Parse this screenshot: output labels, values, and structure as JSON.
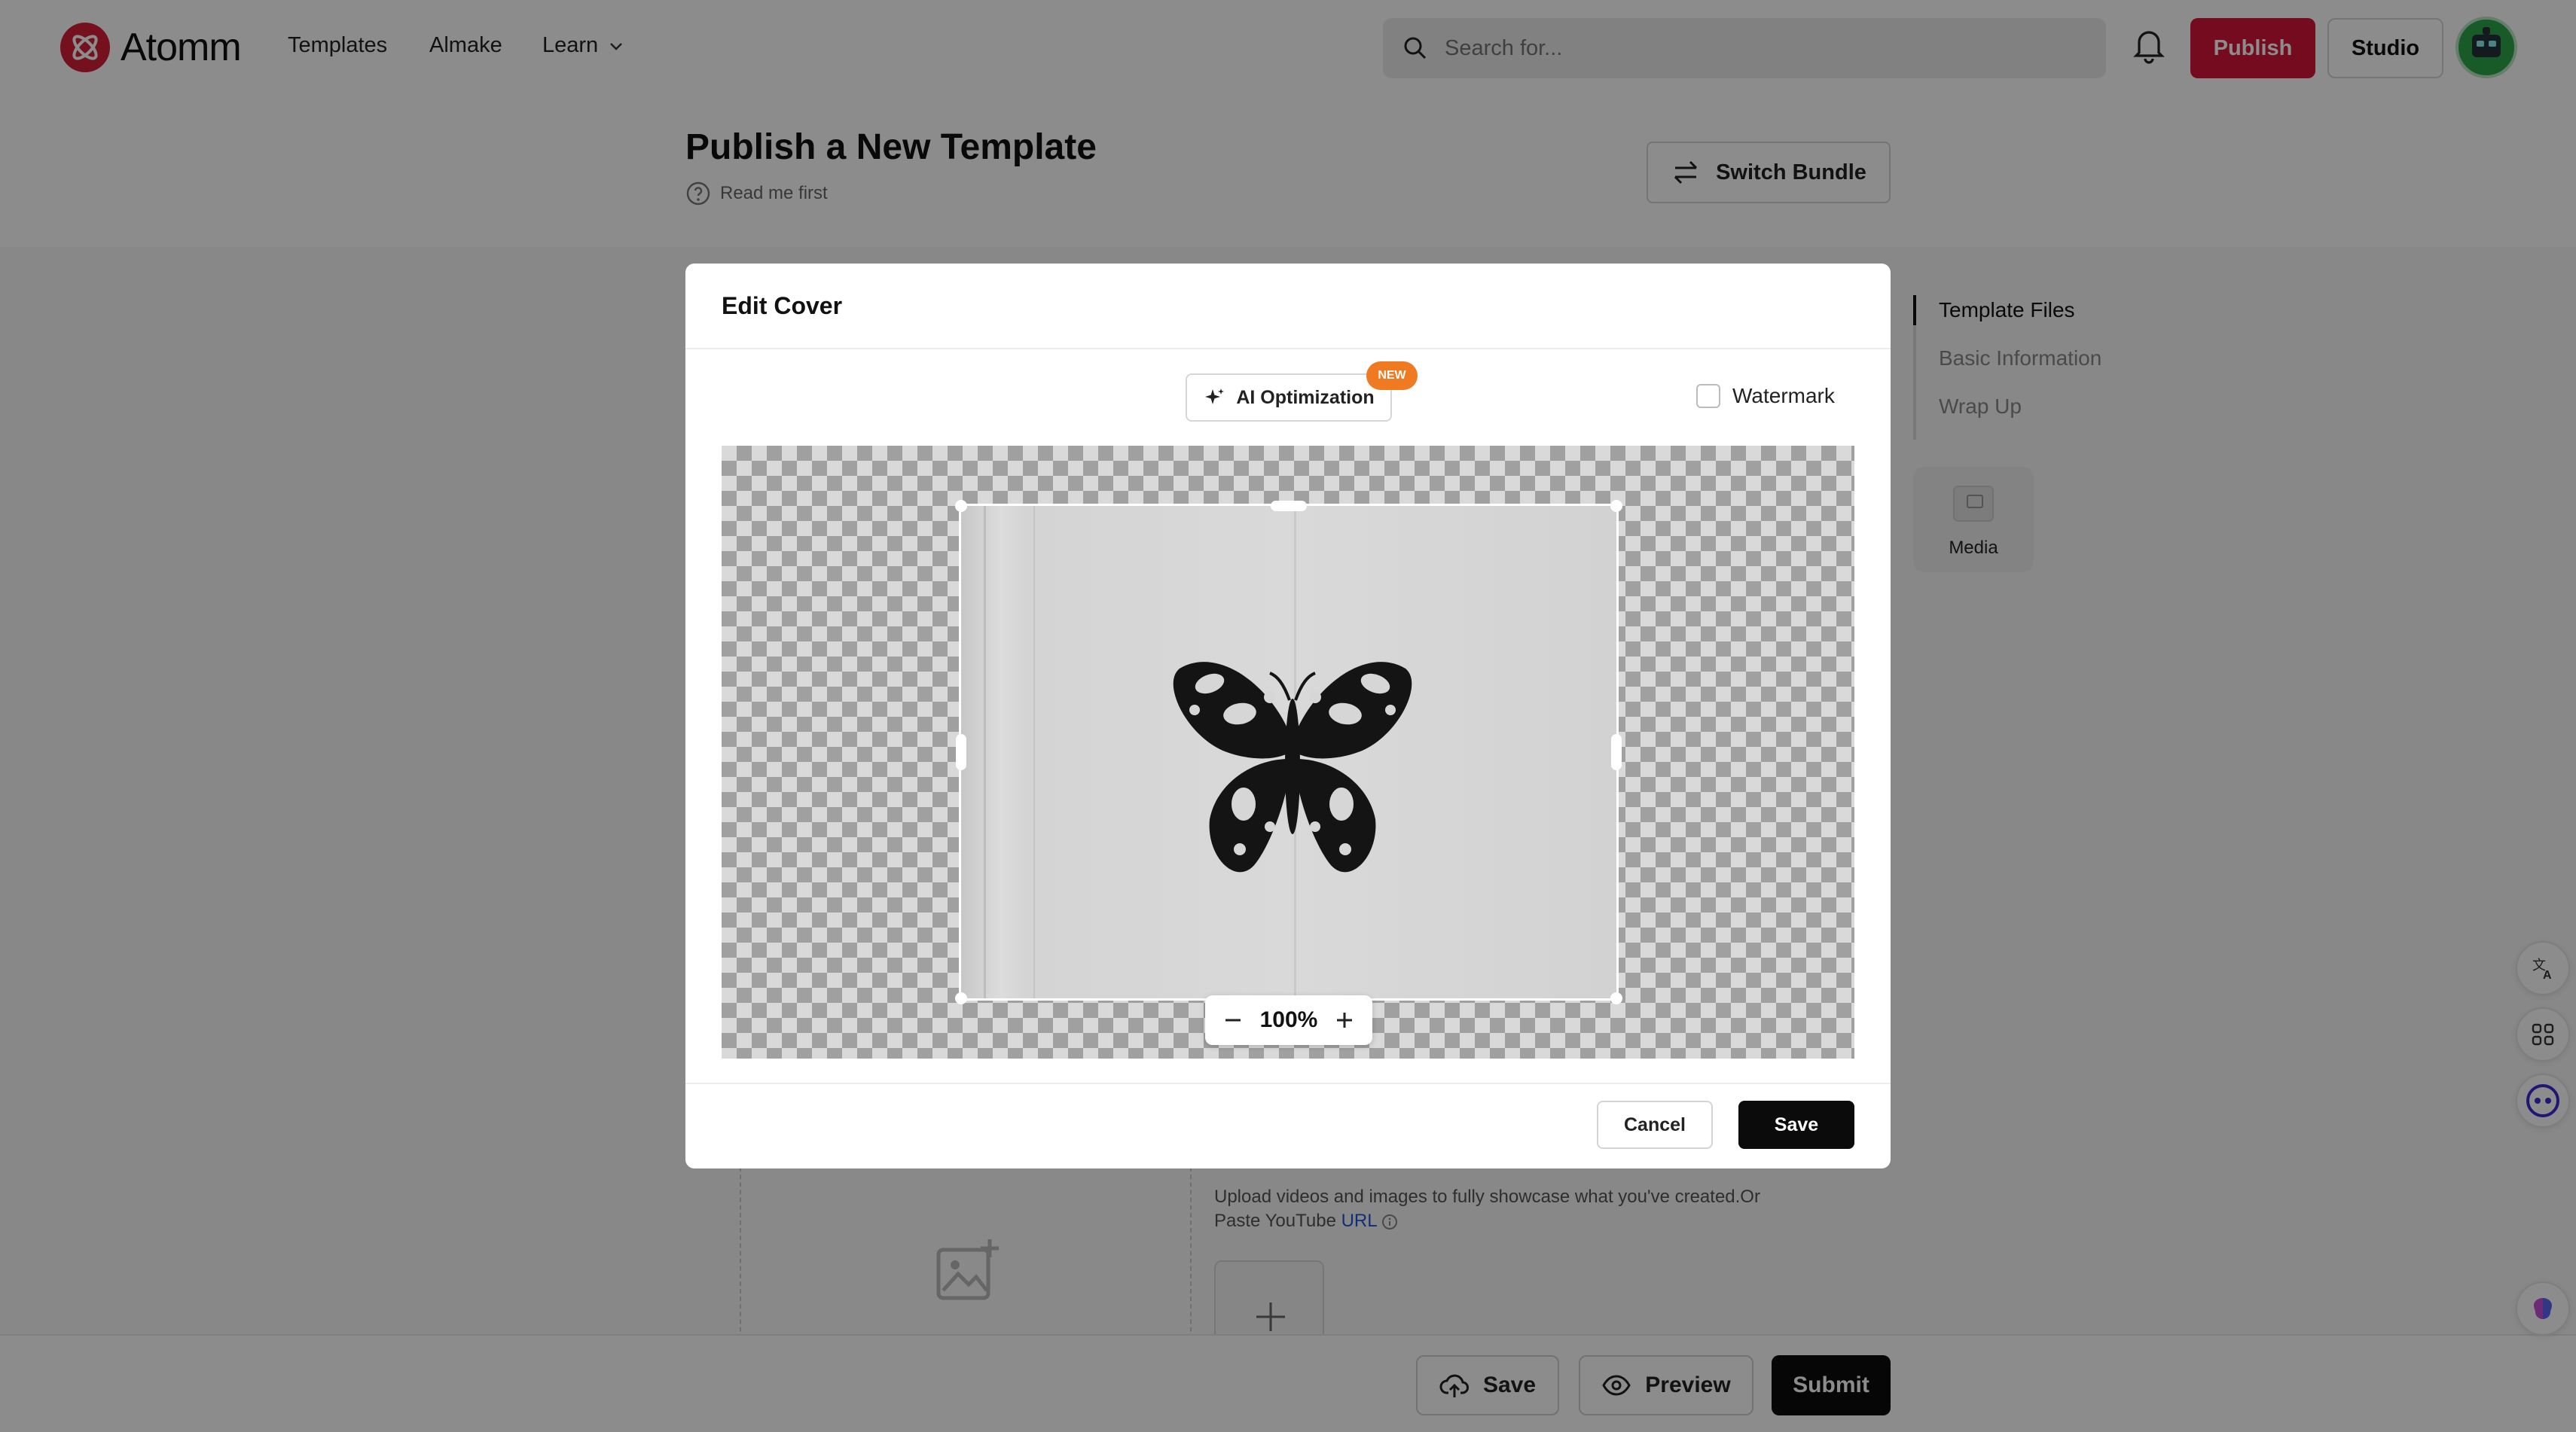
{
  "app": {
    "logo_text": "Atomm",
    "brand_color": "#d6143a",
    "nav": [
      "Templates",
      "Almake",
      "Learn"
    ]
  },
  "header": {
    "search_placeholder": "Search for...",
    "publish_label": "Publish",
    "studio_label": "Studio"
  },
  "page": {
    "title": "Publish a New Template",
    "read_me": "Read me first",
    "switch_bundle": "Switch Bundle"
  },
  "steps": [
    "Template Files",
    "Basic Information",
    "Wrap Up"
  ],
  "media_card_label": "Media",
  "upload": {
    "text": "Upload videos and images to fully showcase what you've created.Or Paste YouTube",
    "url_label": "URL"
  },
  "bottom_bar": {
    "save": "Save",
    "preview": "Preview",
    "submit": "Submit"
  },
  "modal": {
    "title": "Edit Cover",
    "ai_label": "AI Optimization",
    "new_badge": "NEW",
    "watermark_label": "Watermark",
    "watermark_checked": false,
    "zoom": "100%",
    "cancel": "Cancel",
    "save": "Save"
  }
}
